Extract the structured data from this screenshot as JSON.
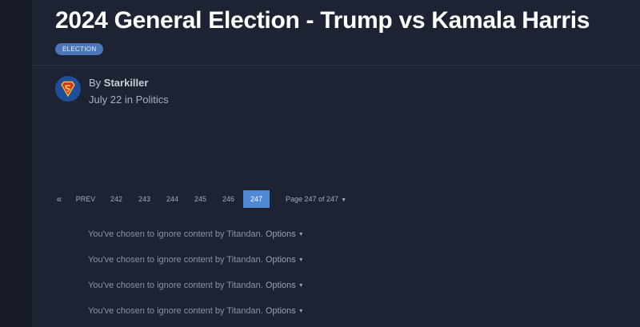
{
  "topic": {
    "title": "2024 General Election - Trump vs Kamala Harris",
    "tag": "ELECTION"
  },
  "post": {
    "by_prefix": "By",
    "author": "Starkiller",
    "date": "July 22",
    "in_word": "in",
    "forum": "Politics",
    "avatar_icon": "superman-shield-icon"
  },
  "pagination": {
    "first_glyph": "«",
    "prev_label": "PREV",
    "pages": [
      "242",
      "243",
      "244",
      "245",
      "246"
    ],
    "current_page": "247",
    "jump_label": "Page 247 of 247",
    "caret_glyph": "▼"
  },
  "ignored": {
    "items": [
      {
        "text": "You've chosen to ignore content by Titandan.",
        "options": "Options"
      },
      {
        "text": "You've chosen to ignore content by Titandan.",
        "options": "Options"
      },
      {
        "text": "You've chosen to ignore content by Titandan.",
        "options": "Options"
      },
      {
        "text": "You've chosen to ignore content by Titandan.",
        "options": "Options"
      }
    ]
  },
  "colors": {
    "background": "#1e2333",
    "accent": "#4f8ad6",
    "tag": "#4b77b8"
  }
}
